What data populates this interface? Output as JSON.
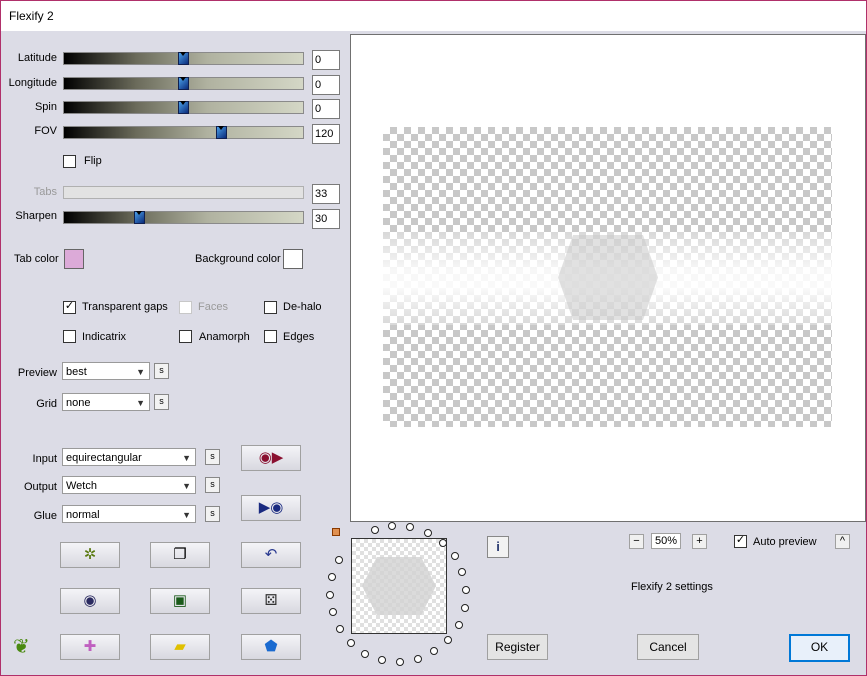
{
  "window": {
    "title": "Flexify 2"
  },
  "sliders": [
    {
      "label": "Latitude",
      "value": "0",
      "level": 0.5,
      "enabled": true
    },
    {
      "label": "Longitude",
      "value": "0",
      "level": 0.5,
      "enabled": true
    },
    {
      "label": "Spin",
      "value": "0",
      "level": 0.5,
      "enabled": true
    },
    {
      "label": "FOV",
      "value": "120",
      "level": 0.67,
      "enabled": true
    },
    {
      "label": "Tabs",
      "value": "33",
      "level": 0.33,
      "enabled": false
    },
    {
      "label": "Sharpen",
      "value": "30",
      "level": 0.3,
      "enabled": true
    }
  ],
  "flip": {
    "label": "Flip",
    "checked": false
  },
  "colors": {
    "tab_color_label": "Tab color",
    "tab_color": "#dcaad8",
    "background_color_label": "Background color",
    "background_color": "#ffffff"
  },
  "options": {
    "transparent_gaps": {
      "label": "Transparent gaps",
      "checked": true
    },
    "faces": {
      "label": "Faces",
      "checked": false,
      "enabled": false
    },
    "de_halo": {
      "label": "De-halo",
      "checked": false
    },
    "indicatrix": {
      "label": "Indicatrix",
      "checked": false
    },
    "anamorph": {
      "label": "Anamorph",
      "checked": false
    },
    "edges": {
      "label": "Edges",
      "checked": false
    }
  },
  "preview_mode": {
    "label": "Preview",
    "value": "best"
  },
  "grid": {
    "label": "Grid",
    "value": "none"
  },
  "input": {
    "label": "Input",
    "value": "equirectangular"
  },
  "output": {
    "label": "Output",
    "value": "Wetch"
  },
  "glue": {
    "label": "Glue",
    "value": "normal"
  },
  "small_button_glyph": "s",
  "zoom": {
    "value": "50%",
    "minus": "−",
    "plus": "+"
  },
  "auto_preview": {
    "label": "Auto preview",
    "checked": true
  },
  "collapse_glyph": "^",
  "status_text": "Flexify 2 settings",
  "info_glyph": "i",
  "buttons": {
    "register": "Register",
    "cancel": "Cancel",
    "ok": "OK"
  },
  "icons": {
    "input_convert": "◉▶",
    "output_convert": "▶◉",
    "randomize_filter": "✲",
    "copy": "❐",
    "undo": "↶",
    "ring": "◉",
    "frame": "▣",
    "dice": "⚄",
    "logo": "❦",
    "cross": "✚",
    "brick": "▰",
    "gem": "⬟"
  },
  "accent_colors": {
    "ok_border": "#0078d7",
    "window_border": "#b0306a",
    "gem": "#1a6ad0"
  }
}
